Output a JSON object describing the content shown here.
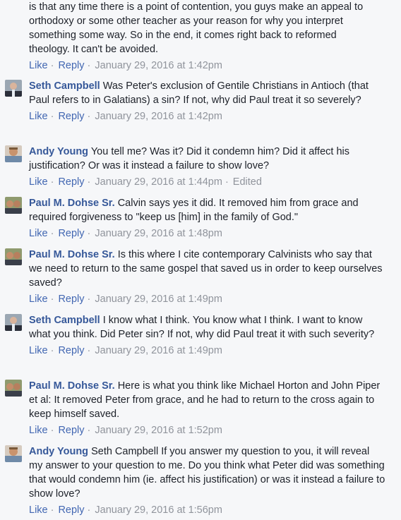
{
  "actions": {
    "like": "Like",
    "reply": "Reply",
    "separator": "·",
    "edited": "Edited"
  },
  "comments": [
    {
      "author": "",
      "text": "is that any time there is a point of contention, you guys make an appeal to orthodoxy or some other teacher as your reason for why you interpret something some way. So in the end, it comes right back to reformed theology. It can't be avoided.",
      "timestamp": "January 29, 2016 at 1:42pm"
    },
    {
      "author": "Seth Campbell",
      "text": "Was Peter's exclusion of Gentile Christians in Antioch (that Paul refers to in Galatians) a sin? If not, why did Paul treat it so severely?",
      "timestamp": "January 29, 2016 at 1:42pm"
    },
    {
      "author": "Andy Young",
      "text": "You tell me? Was it? Did it condemn him? Did it affect his justification? Or was it instead a failure to show love?",
      "timestamp": "January 29, 2016 at 1:44pm"
    },
    {
      "author": "Paul M. Dohse Sr.",
      "text": "Calvin says yes it did. It removed him from grace and required forgiveness to \"keep us [him] in the family of God.\"",
      "timestamp": "January 29, 2016 at 1:48pm"
    },
    {
      "author": "Paul M. Dohse Sr.",
      "text": "Is this where I cite contemporary Calvinists who say that we need to return to the same gospel that saved us in order to keep ourselves saved?",
      "timestamp": "January 29, 2016 at 1:49pm"
    },
    {
      "author": "Seth Campbell",
      "text": "I know what I think. You know what I think. I want to know what you think. Did Peter sin? If not, why did Paul treat it with such severity?",
      "timestamp": "January 29, 2016 at 1:49pm"
    },
    {
      "author": "Paul M. Dohse Sr.",
      "text": "Here is what you think like Michael Horton and John Piper et al: It removed Peter from grace, and he had to return to the cross again to keep himself saved.",
      "timestamp": "January 29, 2016 at 1:52pm"
    },
    {
      "author": "Andy Young",
      "text": "Seth Campbell If you answer my question to you, it will reveal my answer to your question to me. Do you think what Peter did was something that would condemn him (ie. affect his justification) or was it instead a failure to show love?",
      "timestamp": "January 29, 2016 at 1:56pm"
    }
  ]
}
